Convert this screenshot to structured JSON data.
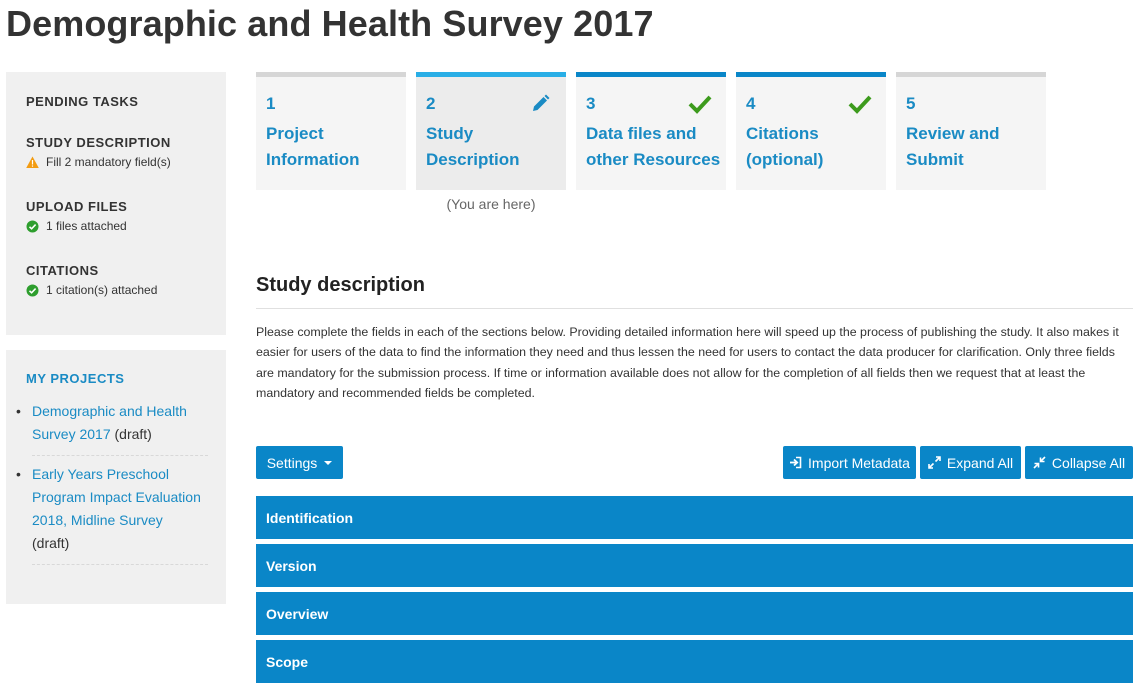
{
  "page": {
    "title": "Demographic and Health Survey 2017"
  },
  "pending": {
    "heading": "PENDING TASKS",
    "tasks": [
      {
        "title": "STUDY DESCRIPTION",
        "status": "Fill 2 mandatory field(s)",
        "icon": "warning-icon"
      },
      {
        "title": "UPLOAD FILES",
        "status": "1 files attached",
        "icon": "check-circle-icon"
      },
      {
        "title": "CITATIONS",
        "status": "1 citation(s) attached",
        "icon": "check-circle-icon"
      }
    ]
  },
  "projects": {
    "heading": "MY PROJECTS",
    "items": [
      {
        "name": "Demographic and Health Survey 2017",
        "status": "(draft)"
      },
      {
        "name": "Early Years Preschool Program Impact Evaluation 2018, Midline Survey",
        "status": "(draft)"
      }
    ]
  },
  "steps": [
    {
      "number": "1",
      "label": "Project Information",
      "state": "default"
    },
    {
      "number": "2",
      "label": "Study Description",
      "state": "active",
      "icon": "pencil-icon"
    },
    {
      "number": "3",
      "label": "Data files and other Resources",
      "state": "done",
      "icon": "check-icon"
    },
    {
      "number": "4",
      "label": "Citations (optional)",
      "state": "done",
      "icon": "check-icon"
    },
    {
      "number": "5",
      "label": "Review and Submit",
      "state": "default"
    }
  ],
  "you_are_here": "(You are here)",
  "study": {
    "heading": "Study description",
    "intro": "Please complete the fields in each of the sections below. Providing detailed information here will speed up the process of publishing the study. It also makes it easier for users of the data to find the information they need and thus lessen the need for users to contact the data producer for clarification. Only three fields are mandatory for the submission process. If time or information available does not allow for the completion of all fields then we request that at least the mandatory and recommended fields be completed."
  },
  "toolbar": {
    "settings": "Settings",
    "import": "Import Metadata",
    "expand": "Expand All",
    "collapse": "Collapse All"
  },
  "sections": [
    "Identification",
    "Version",
    "Overview",
    "Scope"
  ],
  "colors": {
    "primary": "#0a86c8",
    "link": "#1a8bc4",
    "active_bar": "#29aee6",
    "success": "#2e9e2e",
    "warning": "#f39c12"
  }
}
